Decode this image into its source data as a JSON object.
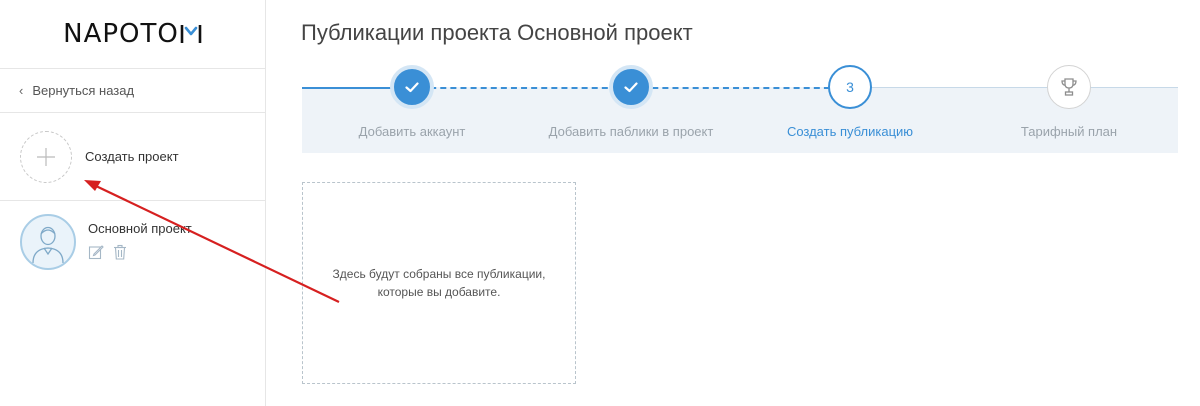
{
  "logo": {
    "text": "NAPOTO"
  },
  "sidebar": {
    "back_label": "Вернуться назад",
    "create_label": "Создать проект",
    "projects": [
      {
        "name": "Основной проект"
      }
    ]
  },
  "main": {
    "title": "Публикации проекта Основной проект",
    "steps": [
      {
        "label": "Добавить аккаунт",
        "state": "done"
      },
      {
        "label": "Добавить паблики в проект",
        "state": "done"
      },
      {
        "label": "Создать публикацию",
        "state": "current",
        "number": "3"
      },
      {
        "label": "Тарифный план",
        "state": "future",
        "icon": "trophy-icon"
      }
    ],
    "empty_text": "Здесь будут собраны все публикации, которые вы добавите."
  },
  "colors": {
    "accent": "#3a8fd6",
    "stepper_bg": "#eef3f8",
    "annotation_arrow": "#d62020"
  }
}
